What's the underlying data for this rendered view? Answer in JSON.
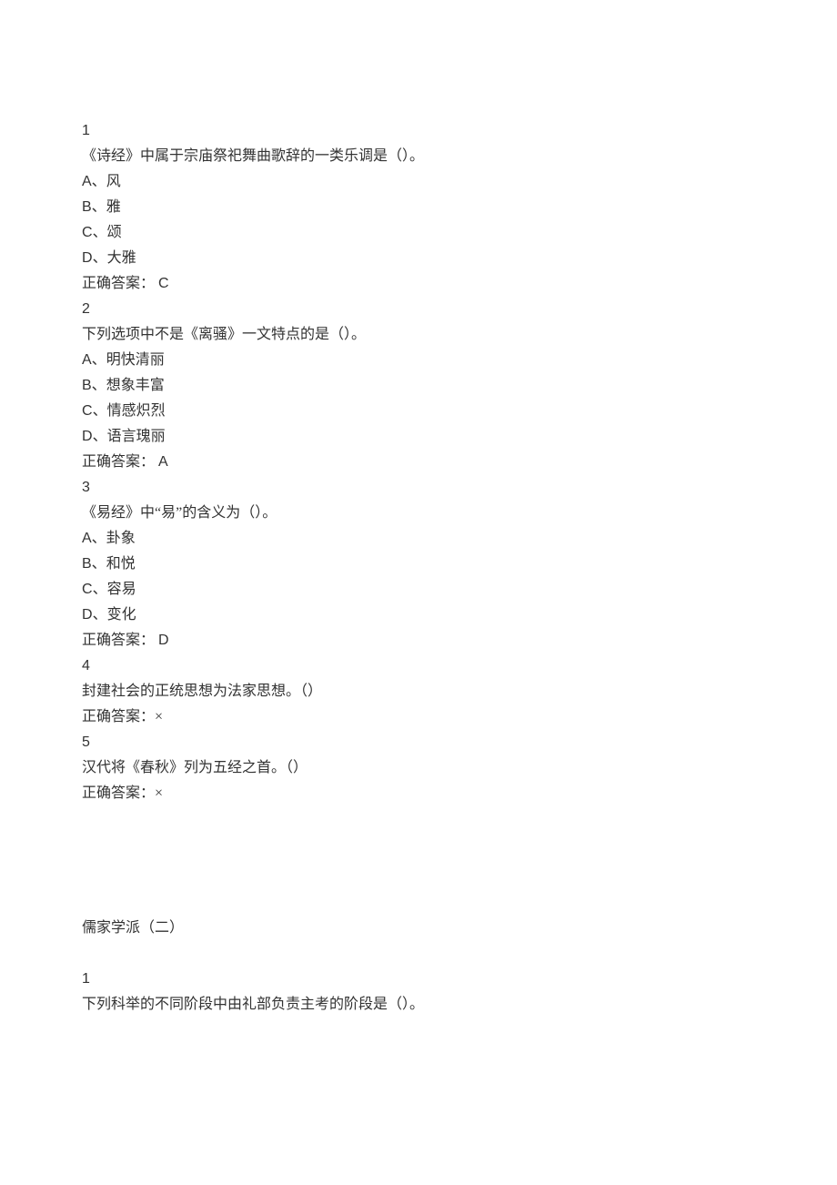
{
  "questions": [
    {
      "number": "1",
      "stem": "《诗经》中属于宗庙祭祀舞曲歌辞的一类乐调是（）。",
      "options": [
        {
          "letter": "A",
          "text": "风"
        },
        {
          "letter": "B",
          "text": "雅"
        },
        {
          "letter": "C",
          "text": "颂"
        },
        {
          "letter": "D",
          "text": "大雅"
        }
      ],
      "answer_label": "正确答案：",
      "answer_value": "C"
    },
    {
      "number": "2",
      "stem": "下列选项中不是《离骚》一文特点的是（）。",
      "options": [
        {
          "letter": "A",
          "text": "明快清丽"
        },
        {
          "letter": "B",
          "text": "想象丰富"
        },
        {
          "letter": "C",
          "text": "情感炽烈"
        },
        {
          "letter": "D",
          "text": "语言瑰丽"
        }
      ],
      "answer_label": "正确答案：",
      "answer_value": "A"
    },
    {
      "number": "3",
      "stem": "《易经》中“易”的含义为（）。",
      "options": [
        {
          "letter": "A",
          "text": "卦象"
        },
        {
          "letter": "B",
          "text": "和悦"
        },
        {
          "letter": "C",
          "text": "容易"
        },
        {
          "letter": "D",
          "text": "变化"
        }
      ],
      "answer_label": "正确答案：",
      "answer_value": "D"
    },
    {
      "number": "4",
      "stem": "封建社会的正统思想为法家思想。（）",
      "options": [],
      "answer_label": "正确答案：",
      "answer_value": "×"
    },
    {
      "number": "5",
      "stem": "汉代将《春秋》列为五经之首。（）",
      "options": [],
      "answer_label": "正确答案：",
      "answer_value": "×"
    }
  ],
  "section_heading": "儒家学派（二）",
  "next_question": {
    "number": "1",
    "stem": "下列科举的不同阶段中由礼部负责主考的阶段是（）。"
  },
  "sep_cn": "、",
  "sep_answer_space": " "
}
